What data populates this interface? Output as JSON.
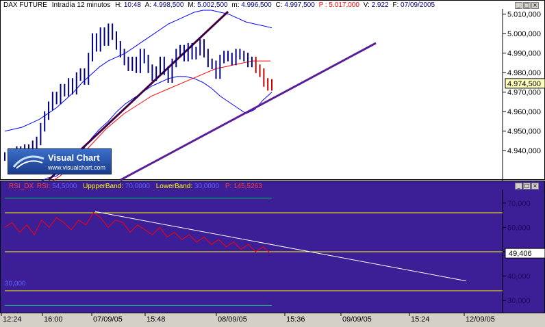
{
  "price_header": {
    "instrument": "DAX FUTURE",
    "interval": "Intradía 12 minutos",
    "h_label": "H:",
    "h_value": "10:48",
    "a_label": "A:",
    "a_value": "4.998,500",
    "m_label": "M:",
    "m_value": "5.002,500",
    "mn_label": "m:",
    "mn_value": "4.996,500",
    "c_label": "C:",
    "c_value": "4.997,500",
    "p_label": "P :",
    "p_value": "5.017,000",
    "v_label": "V:",
    "v_value": "2.922",
    "f_label": "F:",
    "f_value": "07/09/2005"
  },
  "rsi_header": {
    "name": "RSI_DX",
    "rsi_label": "RSI:",
    "rsi_value": "54,5000",
    "upper_label": "UppperBand:",
    "upper_value": "70,0000",
    "lower_label": "LowerBand:",
    "lower_value": "30,0000",
    "p_label": "P:",
    "p_value": "145,5263"
  },
  "logo": {
    "brand": "Visual Chart",
    "url": "www.visualchart.com"
  },
  "colors": {
    "price": "#000080",
    "bollinger": "#0000ff",
    "ma": "#ff0000",
    "trendline_upper": "#400040",
    "trendline_lower": "#5a1e96",
    "rsi_bg": "#3c1e96",
    "rsi_line": "#ff0000",
    "band_line": "#ffff00",
    "band_outer": "#00c864",
    "rsi_trend": "#ffffff",
    "label_box": "#ffffc0"
  },
  "chart_data": [
    {
      "type": "line",
      "title": "DAX FUTURE Intradía 12 minutos",
      "ylim": [
        4925,
        5012
      ],
      "y_ticks": [
        "5.010,000",
        "5.000,000",
        "4.990,000",
        "4.980,000",
        "4.970,000",
        "4.960,000",
        "4.950,000",
        "4.940,000"
      ],
      "last_value_label": "4.974,500",
      "series": [
        {
          "values": [
            4937,
            4935,
            4938,
            4940,
            4936,
            4941,
            4939,
            4943,
            4945,
            4952,
            4958,
            4963,
            4968,
            4966,
            4972,
            4970,
            4975,
            4971,
            4978,
            4980,
            4976,
            4988,
            4998,
            4993,
            5001,
            4996,
            5003,
            4999,
            4994,
            4990,
            4986,
            4983,
            4986,
            4982,
            4990,
            4987,
            4982,
            4978,
            4981,
            4986,
            4981,
            4977,
            4985,
            4990,
            4992,
            4988,
            4993,
            4989,
            4991,
            4995,
            4990,
            4985,
            4984,
            4979,
            4987,
            4989,
            4988,
            4986,
            4990,
            4989,
            4988,
            4985,
            4986,
            4982,
            4980,
            4975,
            4973,
            4974.5
          ]
        },
        {
          "values": [
            4950,
            4951,
            4952,
            4954,
            4956,
            4959,
            4962,
            4966,
            4970,
            4975,
            4979,
            4983,
            4986,
            4988,
            4990,
            4993,
            4996,
            4999,
            5002,
            5005,
            5007,
            5009,
            5011,
            5012,
            5012,
            5011,
            5010,
            5008,
            5006,
            5005,
            5004,
            5003
          ]
        },
        {
          "values": [
            4920,
            4921,
            4922,
            4923,
            4924,
            4926,
            4927,
            4930,
            4935,
            4940,
            4946,
            4951,
            4955,
            4960,
            4964,
            4967,
            4970,
            4973,
            4975,
            4977,
            4978,
            4978,
            4977,
            4975,
            4972,
            4968,
            4965,
            4962,
            4959,
            4961,
            4966,
            4970
          ]
        },
        {
          "values": [
            4922,
            4924,
            4927,
            4931,
            4936,
            4941,
            4946,
            4951,
            4955,
            4959,
            4962,
            4965,
            4968,
            4970,
            4972,
            4974,
            4976,
            4978,
            4980,
            4982,
            4983,
            4984,
            4985,
            4986,
            4986,
            4986
          ]
        }
      ]
    },
    {
      "type": "line",
      "ylim": [
        25,
        75
      ],
      "y_ticks": [
        "70,000",
        "60,000",
        "50,000",
        "40,000",
        "30,000"
      ],
      "last_value_label": "49,406",
      "band_labels": [
        "70,000",
        "30,000"
      ],
      "series": [
        {
          "values": [
            60,
            62,
            58,
            61,
            57,
            63,
            60,
            64,
            62,
            59,
            63,
            61,
            66,
            64,
            60,
            63,
            62,
            58,
            61,
            59,
            57,
            60,
            56,
            58,
            55,
            57,
            54,
            56,
            53,
            55,
            52,
            54,
            51,
            53,
            50,
            52,
            49.4
          ]
        }
      ]
    }
  ],
  "x_axis": {
    "labels": [
      "12:24",
      "16:00",
      "07/09/05",
      "15:48",
      "08/09/05",
      "15:36",
      "09/09/05",
      "15:24",
      "12/09/05"
    ]
  }
}
